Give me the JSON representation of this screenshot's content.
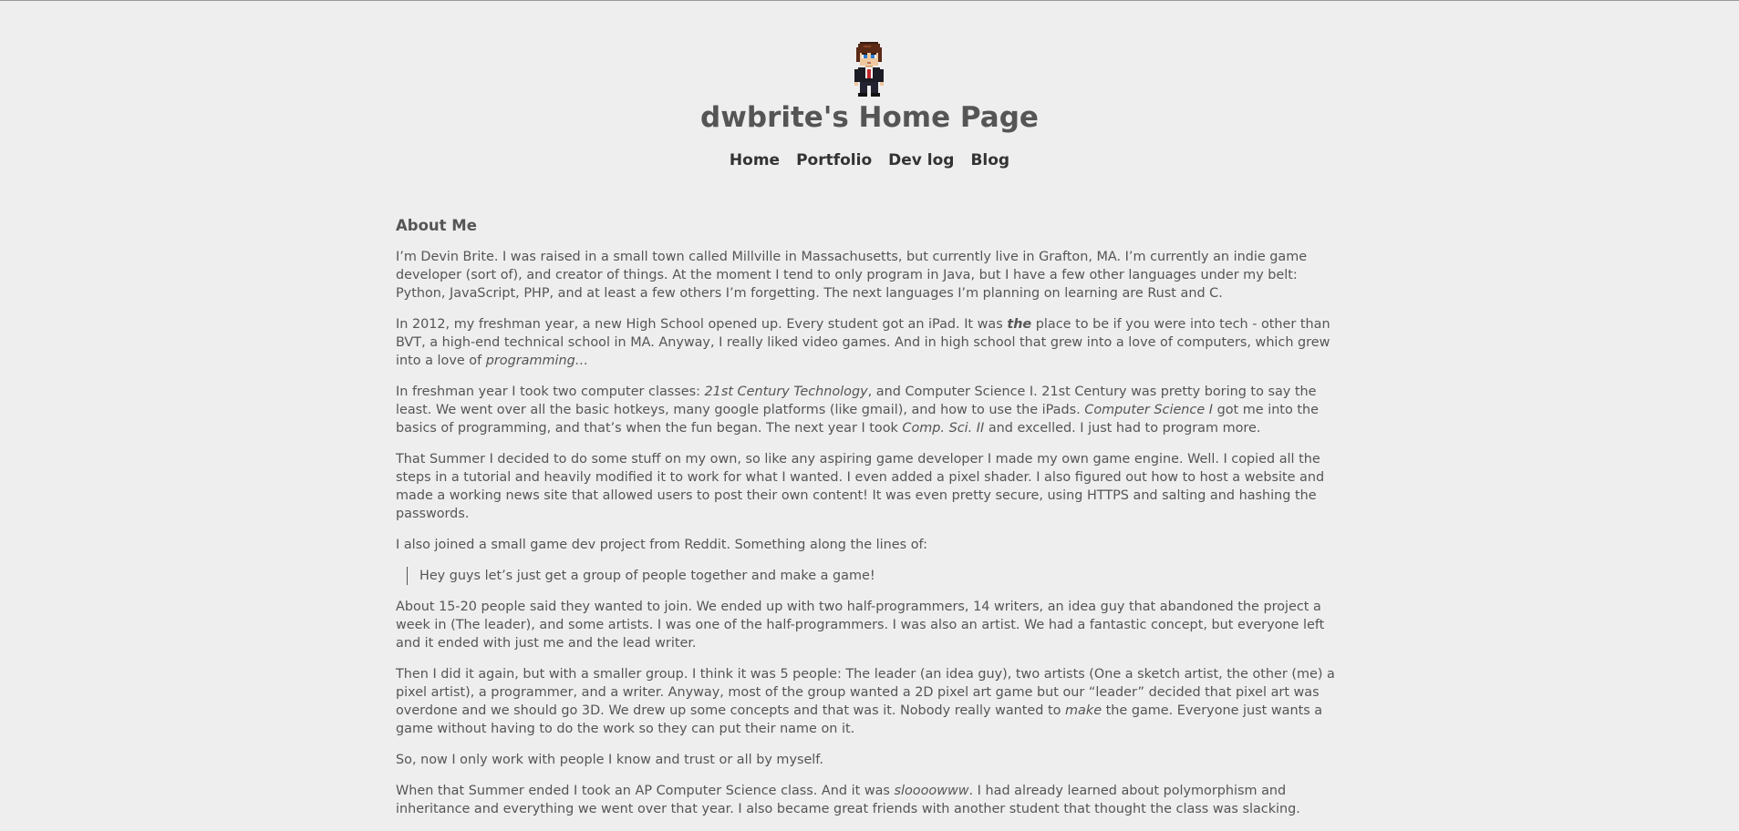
{
  "site": {
    "title": "dwbrite's Home Page"
  },
  "nav": {
    "items": [
      {
        "label": "Home"
      },
      {
        "label": "Portfolio"
      },
      {
        "label": "Dev log"
      },
      {
        "label": "Blog"
      }
    ]
  },
  "article": {
    "heading": "About Me",
    "p1": "I’m Devin Brite. I was raised in a small town called Millville in Massachusetts, but currently live in Grafton, MA. I’m currently an indie game developer (sort of), and creator of things. At the moment I tend to only program in Java, but I have a few other languages under my belt: Python, JavaScript, PHP, and at least a few others I’m forgetting. The next languages I’m planning on learning are Rust and C.",
    "p2": {
      "a": "In 2012, my freshman year, a new High School opened up. Every student got an iPad. It was ",
      "b": "the",
      "c": " place to be if you were into tech - other than BVT, a high-end technical school in MA. Anyway, I really liked video games. And in high school that grew into a love of computers, which grew into a love of ",
      "d": "programming…"
    },
    "p3": {
      "a": "In freshman year I took two computer classes: ",
      "b": "21st Century Technology",
      "c": ", and Computer Science I. 21st Century was pretty boring to say the least. We went over all the basic hotkeys, many google platforms (like gmail), and how to use the iPads. ",
      "d": "Computer Science I",
      "e": " got me into the basics of programming, and that’s when the fun began. The next year I took ",
      "f": "Comp. Sci. II",
      "g": " and excelled. I just had to program more."
    },
    "p4": "That Summer I decided to do some stuff on my own, so like any aspiring game developer I made my own game engine. Well. I copied all the steps in a tutorial and heavily modified it to work for what I wanted. I even added a pixel shader. I also figured out how to host a website and made a working news site that allowed users to post their own content! It was even pretty secure, using HTTPS and salting and hashing the passwords.",
    "p5": "I also joined a small game dev project from Reddit. Something along the lines of:",
    "quote": "Hey guys let’s just get a group of people together and make a game!",
    "p6": "About 15-20 people said they wanted to join. We ended up with two half-programmers, 14 writers, an idea guy that abandoned the project a week in (The leader), and some artists. I was one of the half-programmers. I was also an artist. We had a fantastic concept, but everyone left and it ended with just me and the lead writer.",
    "p7": {
      "a": "Then I did it again, but with a smaller group. I think it was 5 people: The leader (an idea guy), two artists (One a sketch artist, the other (me) a pixel artist), a programmer, and a writer. Anyway, most of the group wanted a 2D pixel art game but our “leader” decided that pixel art was overdone and we should go 3D. We drew up some concepts and that was it. Nobody really wanted to ",
      "b": "make",
      "c": " the game. Everyone just wants a game without having to do the work so they can put their name on it."
    },
    "p8": "So, now I only work with people I know and trust or all by myself.",
    "p9": {
      "a": "When that Summer ended I took an AP Computer Science class. And it was ",
      "b": "sloooowww",
      "c": ". I had already learned about polymorphism and inheritance and everything we went over that year. I also became great friends with another student that thought the class was slacking."
    }
  },
  "icons": {
    "avatar": "pixel-art-character-avatar"
  }
}
